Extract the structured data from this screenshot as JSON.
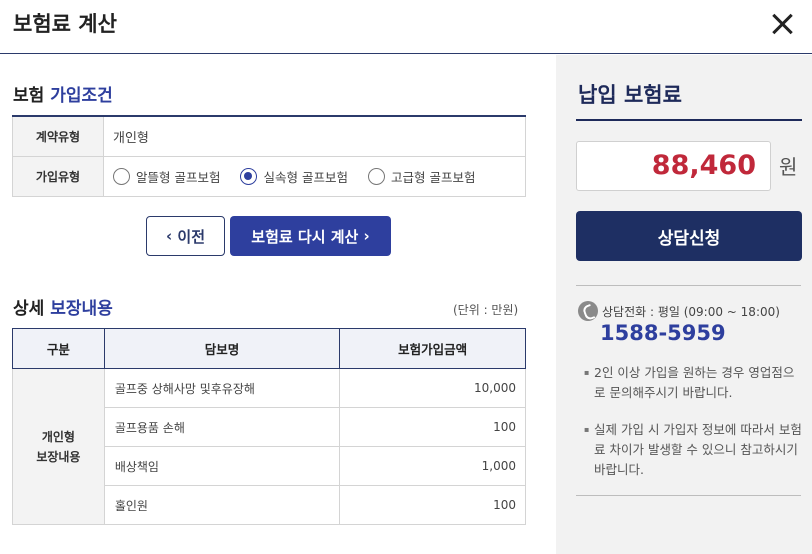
{
  "header": {
    "title": "보험료 계산",
    "close_icon": "close-icon"
  },
  "conditions": {
    "title_plain": "보험",
    "title_highlight": "가입조건",
    "contract_type_label": "계약유형",
    "contract_type_value": "개인형",
    "plan_type_label": "가입유형",
    "plan_options": [
      {
        "label": "알뜰형 골프보험",
        "selected": false
      },
      {
        "label": "실속형 골프보험",
        "selected": true
      },
      {
        "label": "고급형 골프보험",
        "selected": false
      }
    ]
  },
  "buttons": {
    "prev_label": "이전",
    "recalc_label": "보험료 다시 계산"
  },
  "coverage": {
    "title_plain": "상세",
    "title_highlight": "보장내용",
    "unit_note": "(단위 : 만원)",
    "headers": [
      "구분",
      "담보명",
      "보험가입금액"
    ],
    "group_label_line1": "개인형",
    "group_label_line2": "보장내용",
    "rows": [
      {
        "name": "골프중 상해사망 및후유장해",
        "amount": "10,000"
      },
      {
        "name": "골프용품 손해",
        "amount": "100"
      },
      {
        "name": "배상책임",
        "amount": "1,000"
      },
      {
        "name": "홀인원",
        "amount": "100"
      }
    ]
  },
  "premium": {
    "title": "납입 보험료",
    "amount": "88,460",
    "currency": "원",
    "consult_label": "상담신청"
  },
  "contact": {
    "phone_label": "상담전화 : 평일 (09:00 ~ 18:00)",
    "phone_number": "1588-5959",
    "notes": [
      "2인 이상 가입을 원하는 경우 영업점으로 문의해주시기 바랍니다.",
      "실제 가입 시 가입자 정보에 따라서 보험료 차이가 발생할 수 있으니 참고하시기 바랍니다."
    ]
  },
  "colors": {
    "primary": "#2e3f9e",
    "navy": "#1e2f63",
    "price": "#c0283a"
  }
}
